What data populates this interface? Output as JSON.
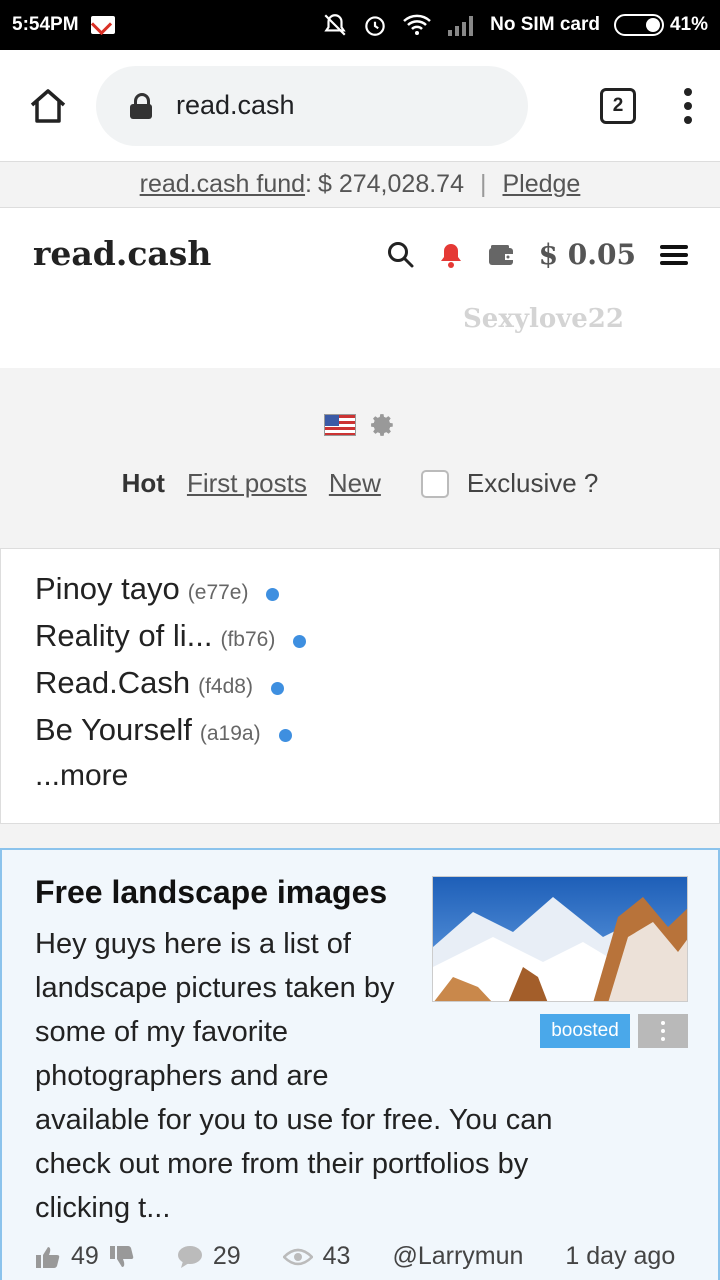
{
  "status_bar": {
    "time": "5:54PM",
    "carrier": "No SIM card",
    "battery": "41%"
  },
  "browser": {
    "url": "read.cash",
    "tab_count": "2"
  },
  "fund_bar": {
    "fund_label": "read.cash fund",
    "colon": ":",
    "fund_amount": "$ 274,028.74",
    "separator": "|",
    "pledge_label": "Pledge"
  },
  "header": {
    "logo": "read.cash",
    "balance": "$ 0.05",
    "username": "Sexylove22"
  },
  "filters": {
    "hot": "Hot",
    "first_posts": "First posts",
    "new": "New",
    "exclusive": "Exclusive ?"
  },
  "communities": {
    "items": [
      {
        "name": "Pinoy tayo",
        "code": "(e77e)"
      },
      {
        "name": "Reality of li...",
        "code": "(fb76)"
      },
      {
        "name": "Read.Cash",
        "code": "(f4d8)"
      },
      {
        "name": "Be Yourself",
        "code": "(a19a)"
      }
    ],
    "more": "...more"
  },
  "article": {
    "title": "Free landscape images",
    "excerpt_narrow": "Hey guys here is a list of landscape pictures taken by some of my favorite photographers and are",
    "excerpt_wide": "available for you to use for free. You can check out more from their portfolios by clicking t...",
    "badge": "boosted",
    "likes": "49",
    "comments": "29",
    "views": "43",
    "author": "@Larrymun",
    "time_ago": "1 day ago"
  },
  "colors": {
    "accent_blue": "#4aa8ea",
    "community_dot": "#3e8fe0",
    "bell_red": "#e53935"
  }
}
